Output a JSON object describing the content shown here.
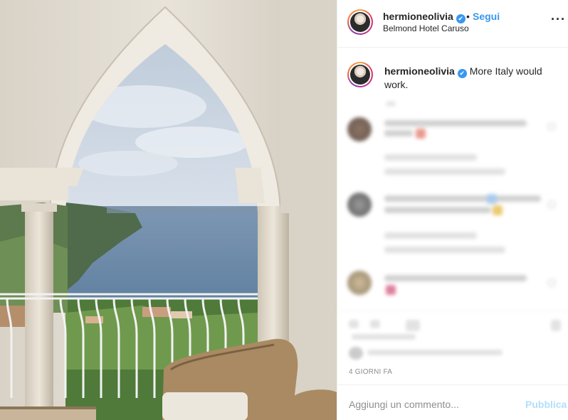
{
  "post": {
    "username": "hermioneolivia",
    "verified_mark": "✔",
    "separator": "•",
    "follow_label": "Segui",
    "location": "Belmond Hotel Caruso",
    "more_icon": "more-horizontal-icon",
    "more_glyph": "···"
  },
  "caption": {
    "username": "hermioneolivia",
    "verified_mark": "✔",
    "text": "More Italy would work."
  },
  "footer": {
    "date": "4 GIORNI FA",
    "comment_placeholder": "Aggiungi un commento...",
    "publish_label": "Pubblica"
  },
  "colors": {
    "link_blue": "#3897f0",
    "publish_disabled": "#b2dffc",
    "muted_text": "#8e8e8e",
    "border": "#efefef"
  }
}
